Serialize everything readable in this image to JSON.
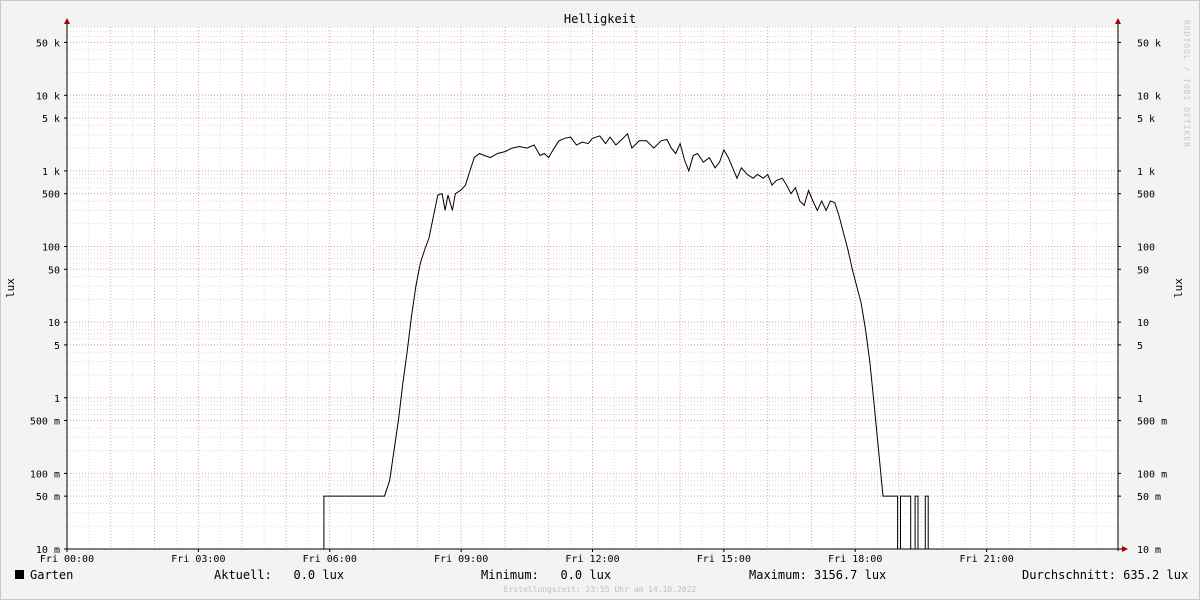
{
  "chart_data": {
    "type": "line",
    "title": "Helligkeit",
    "ylabel": "lux",
    "yscale": "log",
    "ylim": [
      0.01,
      80000
    ],
    "xlim": [
      "00:00",
      "24:00"
    ],
    "grid": true,
    "x_ticks": [
      "Fri 00:00",
      "Fri 03:00",
      "Fri 06:00",
      "Fri 09:00",
      "Fri 12:00",
      "Fri 15:00",
      "Fri 18:00",
      "Fri 21:00"
    ],
    "y_ticks": [
      {
        "value": 50000,
        "label": "50 k"
      },
      {
        "value": 10000,
        "label": "10 k"
      },
      {
        "value": 5000,
        "label": "5 k"
      },
      {
        "value": 1000,
        "label": "1 k"
      },
      {
        "value": 500,
        "label": "500"
      },
      {
        "value": 100,
        "label": "100"
      },
      {
        "value": 50,
        "label": "50"
      },
      {
        "value": 10,
        "label": "10"
      },
      {
        "value": 5,
        "label": "5"
      },
      {
        "value": 1,
        "label": "1"
      },
      {
        "value": 0.5,
        "label": "500 m"
      },
      {
        "value": 0.1,
        "label": "100 m"
      },
      {
        "value": 0.05,
        "label": "50 m"
      },
      {
        "value": 0.01,
        "label": "10 m"
      }
    ],
    "series": [
      {
        "name": "Garten",
        "color": "#000000",
        "points": [
          [
            "00:00",
            0.01
          ],
          [
            "05:52",
            0.01
          ],
          [
            "05:52",
            0.05
          ],
          [
            "07:15",
            0.05
          ],
          [
            "07:22",
            0.08
          ],
          [
            "07:28",
            0.2
          ],
          [
            "07:34",
            0.5
          ],
          [
            "07:40",
            1.5
          ],
          [
            "07:46",
            4
          ],
          [
            "07:52",
            12
          ],
          [
            "07:58",
            30
          ],
          [
            "08:04",
            60
          ],
          [
            "08:10",
            90
          ],
          [
            "08:16",
            130
          ],
          [
            "08:22",
            250
          ],
          [
            "08:28",
            480
          ],
          [
            "08:34",
            500
          ],
          [
            "08:38",
            300
          ],
          [
            "08:42",
            480
          ],
          [
            "08:48",
            300
          ],
          [
            "08:52",
            500
          ],
          [
            "09:00",
            560
          ],
          [
            "09:06",
            650
          ],
          [
            "09:12",
            1000
          ],
          [
            "09:18",
            1500
          ],
          [
            "09:25",
            1700
          ],
          [
            "09:32",
            1600
          ],
          [
            "09:40",
            1500
          ],
          [
            "09:50",
            1700
          ],
          [
            "10:00",
            1800
          ],
          [
            "10:10",
            2000
          ],
          [
            "10:20",
            2100
          ],
          [
            "10:30",
            2000
          ],
          [
            "10:40",
            2200
          ],
          [
            "10:48",
            1600
          ],
          [
            "10:54",
            1700
          ],
          [
            "11:00",
            1500
          ],
          [
            "11:06",
            1900
          ],
          [
            "11:14",
            2500
          ],
          [
            "11:22",
            2700
          ],
          [
            "11:30",
            2800
          ],
          [
            "11:38",
            2200
          ],
          [
            "11:46",
            2400
          ],
          [
            "11:54",
            2300
          ],
          [
            "12:00",
            2700
          ],
          [
            "12:10",
            2900
          ],
          [
            "12:18",
            2300
          ],
          [
            "12:24",
            2800
          ],
          [
            "12:32",
            2200
          ],
          [
            "12:40",
            2600
          ],
          [
            "12:48",
            3100
          ],
          [
            "12:54",
            2000
          ],
          [
            "13:04",
            2500
          ],
          [
            "13:14",
            2500
          ],
          [
            "13:24",
            2000
          ],
          [
            "13:34",
            2500
          ],
          [
            "13:42",
            2600
          ],
          [
            "13:48",
            2000
          ],
          [
            "13:54",
            1700
          ],
          [
            "14:00",
            2300
          ],
          [
            "14:06",
            1400
          ],
          [
            "14:12",
            1000
          ],
          [
            "14:18",
            1600
          ],
          [
            "14:24",
            1700
          ],
          [
            "14:32",
            1300
          ],
          [
            "14:40",
            1500
          ],
          [
            "14:48",
            1100
          ],
          [
            "14:54",
            1300
          ],
          [
            "15:00",
            1900
          ],
          [
            "15:06",
            1500
          ],
          [
            "15:12",
            1100
          ],
          [
            "15:18",
            800
          ],
          [
            "15:24",
            1100
          ],
          [
            "15:32",
            900
          ],
          [
            "15:40",
            800
          ],
          [
            "15:46",
            900
          ],
          [
            "15:54",
            800
          ],
          [
            "16:00",
            900
          ],
          [
            "16:06",
            650
          ],
          [
            "16:12",
            750
          ],
          [
            "16:20",
            800
          ],
          [
            "16:26",
            650
          ],
          [
            "16:32",
            500
          ],
          [
            "16:38",
            600
          ],
          [
            "16:44",
            400
          ],
          [
            "16:50",
            350
          ],
          [
            "16:56",
            550
          ],
          [
            "17:02",
            400
          ],
          [
            "17:08",
            300
          ],
          [
            "17:14",
            400
          ],
          [
            "17:20",
            300
          ],
          [
            "17:26",
            400
          ],
          [
            "17:32",
            380
          ],
          [
            "17:38",
            250
          ],
          [
            "17:44",
            150
          ],
          [
            "17:50",
            90
          ],
          [
            "17:56",
            50
          ],
          [
            "18:02",
            30
          ],
          [
            "18:08",
            18
          ],
          [
            "18:14",
            8
          ],
          [
            "18:20",
            3
          ],
          [
            "18:26",
            0.8
          ],
          [
            "18:32",
            0.2
          ],
          [
            "18:38",
            0.05
          ],
          [
            "18:58",
            0.05
          ],
          [
            "18:58",
            0.01
          ],
          [
            "19:02",
            0.01
          ],
          [
            "19:02",
            0.05
          ],
          [
            "19:16",
            0.05
          ],
          [
            "19:16",
            0.01
          ],
          [
            "19:22",
            0.01
          ],
          [
            "19:22",
            0.05
          ],
          [
            "19:26",
            0.05
          ],
          [
            "19:26",
            0.01
          ],
          [
            "19:36",
            0.01
          ],
          [
            "19:36",
            0.05
          ],
          [
            "19:40",
            0.05
          ],
          [
            "19:40",
            0.01
          ],
          [
            "24:00",
            0.01
          ]
        ]
      }
    ]
  },
  "legend": {
    "series_name": "Garten",
    "current": "Aktuell:   0.0 lux",
    "minimum": "Minimum:   0.0 lux",
    "maximum": "Maximum: 3156.7 lux",
    "average": "Durchschnitt: 635.2 lux"
  },
  "footer": "Erstellungszeit: 23:55 Uhr am 14.10.2022",
  "watermark": "RRDTOOL / TOBI OETIKER",
  "colors": {
    "background": "#f3f3f3",
    "plot_background": "#ffffff",
    "major_grid": "#e6a0a0",
    "minor_grid": "#d8d8d8",
    "axis": "#000000",
    "arrow": "#aa0000"
  }
}
